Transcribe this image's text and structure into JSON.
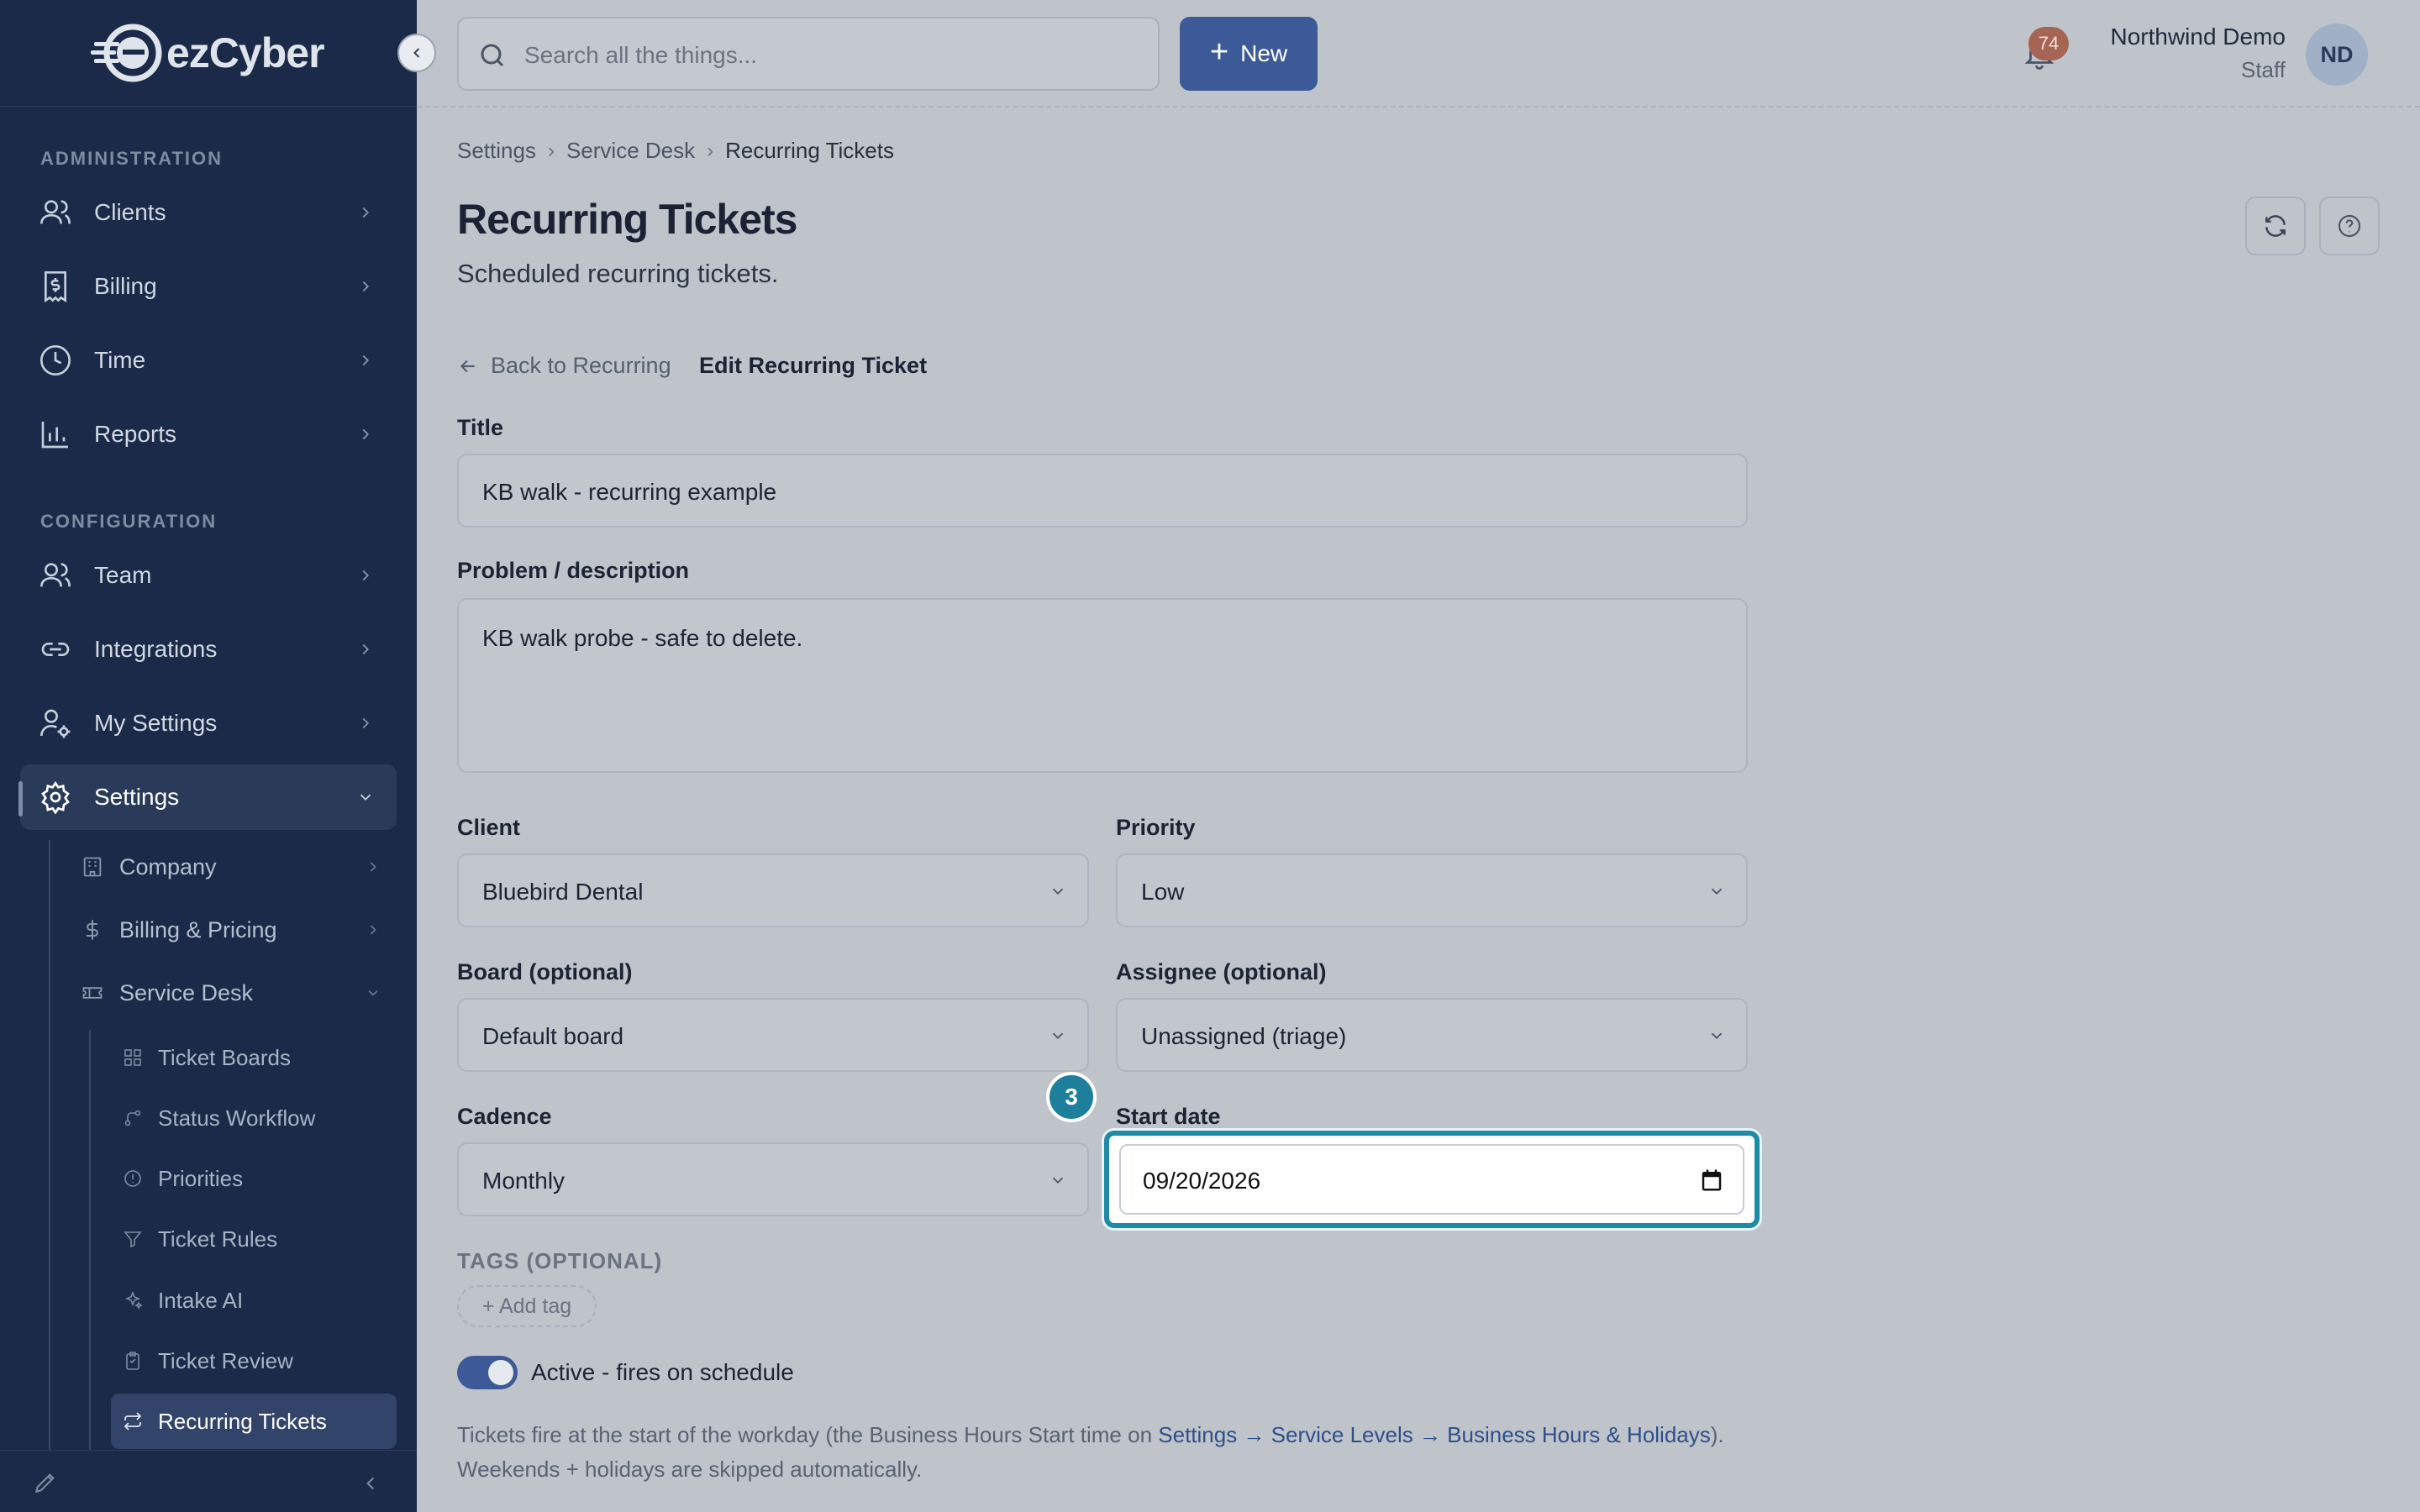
{
  "brand": {
    "name": "ezCyber"
  },
  "sidebar": {
    "section_admin": "ADMINISTRATION",
    "section_config": "CONFIGURATION",
    "admin_items": [
      {
        "label": "Clients",
        "icon": "users-icon"
      },
      {
        "label": "Billing",
        "icon": "receipt-dollar-icon"
      },
      {
        "label": "Time",
        "icon": "clock-icon"
      },
      {
        "label": "Reports",
        "icon": "bar-chart-icon"
      }
    ],
    "config_items": [
      {
        "label": "Team",
        "icon": "users-icon"
      },
      {
        "label": "Integrations",
        "icon": "link-icon"
      },
      {
        "label": "My Settings",
        "icon": "user-gear-icon"
      },
      {
        "label": "Settings",
        "icon": "gear-icon",
        "active": true
      }
    ],
    "settings_children": [
      {
        "label": "Company",
        "icon": "building-icon"
      },
      {
        "label": "Billing & Pricing",
        "icon": "dollar-icon"
      },
      {
        "label": "Service Desk",
        "icon": "ticket-icon",
        "expanded": true
      }
    ],
    "service_desk_children": [
      {
        "label": "Ticket Boards",
        "icon": "grid-icon"
      },
      {
        "label": "Status Workflow",
        "icon": "workflow-icon"
      },
      {
        "label": "Priorities",
        "icon": "alert-circle-icon"
      },
      {
        "label": "Ticket Rules",
        "icon": "filter-icon"
      },
      {
        "label": "Intake AI",
        "icon": "sparkles-icon"
      },
      {
        "label": "Ticket Review",
        "icon": "clipboard-icon"
      },
      {
        "label": "Recurring Tickets",
        "icon": "repeat-icon",
        "active": true
      }
    ]
  },
  "topbar": {
    "search_placeholder": "Search all the things...",
    "new_label": "New",
    "notification_count": "74",
    "user_name": "Northwind Demo",
    "user_role": "Staff",
    "avatar_initials": "ND"
  },
  "breadcrumb": [
    "Settings",
    "Service Desk",
    "Recurring Tickets"
  ],
  "page": {
    "title": "Recurring Tickets",
    "subtitle": "Scheduled recurring tickets.",
    "back_link": "Back to Recurring",
    "edit_label": "Edit Recurring Ticket"
  },
  "form": {
    "title_label": "Title",
    "title_value": "KB walk - recurring example",
    "desc_label": "Problem / description",
    "desc_value": "KB walk probe - safe to delete.",
    "client_label": "Client",
    "client_value": "Bluebird Dental",
    "priority_label": "Priority",
    "priority_value": "Low",
    "board_label": "Board (optional)",
    "board_value": "Default board",
    "assignee_label": "Assignee (optional)",
    "assignee_value": "Unassigned (triage)",
    "cadence_label": "Cadence",
    "cadence_value": "Monthly",
    "start_label": "Start date",
    "start_value": "09/20/2026",
    "step_number": "3",
    "tags_label": "TAGS (OPTIONAL)",
    "add_tag": "+ Add tag",
    "active_label": "Active - fires on schedule",
    "active_on": true
  },
  "note": {
    "prefix": "Tickets fire at the start of the workday (the Business Hours Start time on ",
    "link": "Settings → Service Levels → Business Hours & Holidays",
    "suffix": ").",
    "line2": "Weekends + holidays are skipped automatically."
  },
  "colors": {
    "sidebar_bg": "#1b2a48",
    "accent": "#3d5a98",
    "focus": "#1d8aa6",
    "overlay_bg": "#bfc4cb"
  }
}
